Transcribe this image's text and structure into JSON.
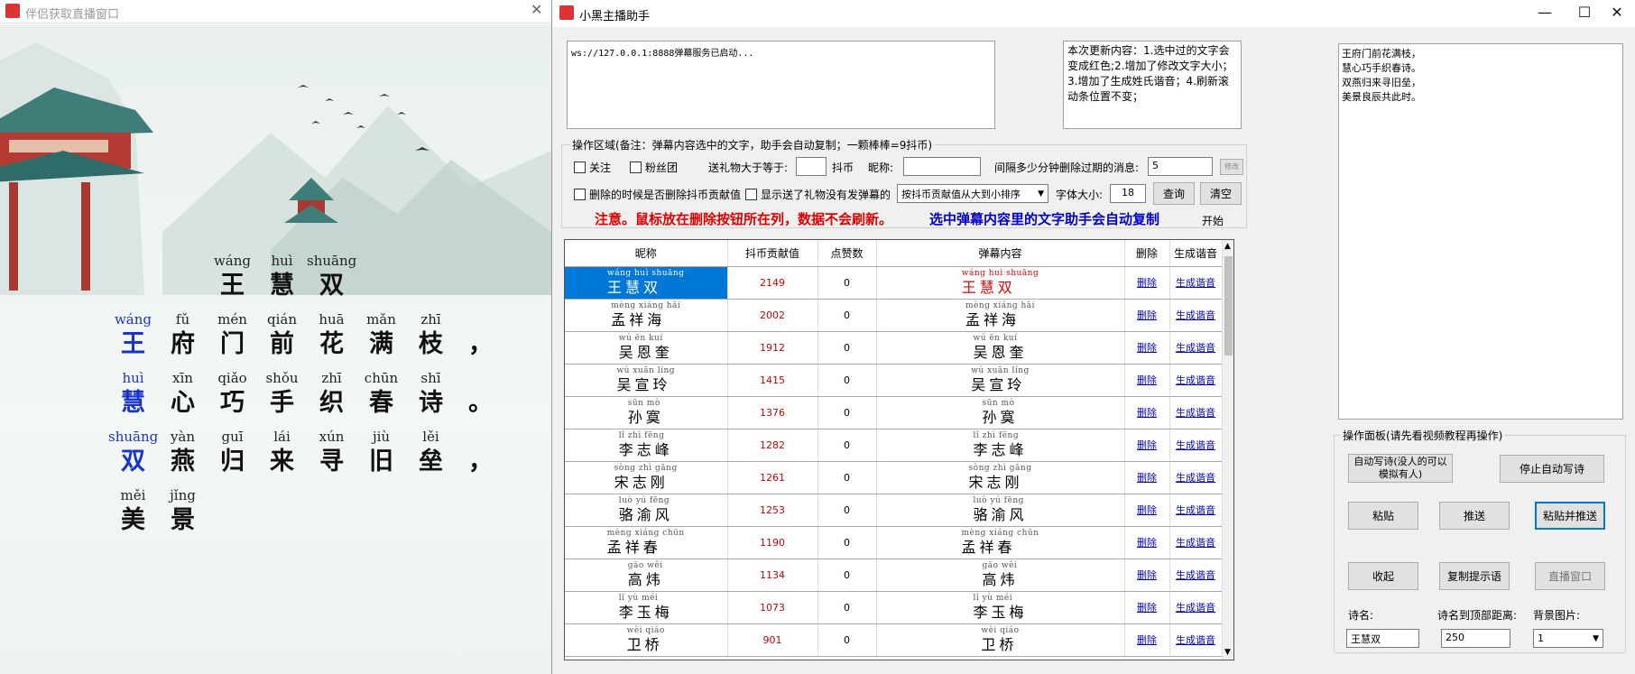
{
  "left_window": {
    "title": "伴侣获取直播窗口",
    "close_glyph": "✕",
    "poem": {
      "title": [
        {
          "py": "wáng",
          "hz": "王",
          "blue": false
        },
        {
          "py": "huì",
          "hz": "慧",
          "blue": false
        },
        {
          "py": "shuāng",
          "hz": "双",
          "blue": false
        }
      ],
      "lines": [
        [
          {
            "py": "wáng",
            "hz": "王",
            "blue": true
          },
          {
            "py": "fǔ",
            "hz": "府"
          },
          {
            "py": "mén",
            "hz": "门"
          },
          {
            "py": "qián",
            "hz": "前"
          },
          {
            "py": "huā",
            "hz": "花"
          },
          {
            "py": "mǎn",
            "hz": "满"
          },
          {
            "py": "zhī",
            "hz": "枝"
          },
          {
            "py": "",
            "hz": "，"
          }
        ],
        [
          {
            "py": "huì",
            "hz": "慧",
            "blue": true
          },
          {
            "py": "xīn",
            "hz": "心"
          },
          {
            "py": "qiǎo",
            "hz": "巧"
          },
          {
            "py": "shǒu",
            "hz": "手"
          },
          {
            "py": "zhī",
            "hz": "织"
          },
          {
            "py": "chūn",
            "hz": "春"
          },
          {
            "py": "shī",
            "hz": "诗"
          },
          {
            "py": "",
            "hz": "。"
          }
        ],
        [
          {
            "py": "shuāng",
            "hz": "双",
            "blue": true
          },
          {
            "py": "yàn",
            "hz": "燕"
          },
          {
            "py": "guī",
            "hz": "归"
          },
          {
            "py": "lái",
            "hz": "来"
          },
          {
            "py": "xún",
            "hz": "寻"
          },
          {
            "py": "jiù",
            "hz": "旧"
          },
          {
            "py": "lěi",
            "hz": "垒"
          },
          {
            "py": "",
            "hz": "，"
          }
        ],
        [
          {
            "py": "měi",
            "hz": "美"
          },
          {
            "py": "jǐng",
            "hz": "景"
          }
        ]
      ]
    }
  },
  "main_window": {
    "title": "小黑主播助手",
    "min_glyph": "—",
    "max_glyph": "☐",
    "close_glyph": "✕",
    "log_text": "ws://127.0.0.1:8888弹幕服务已启动...",
    "update_notes": "本次更新内容：1.选中过的文字会变成红色;2.增加了修改文字大小；3.增加了生成姓氏谐音；4.刷新滚动条位置不变；",
    "poem_output": "王府门前花满枝，\n慧心巧手织春诗。\n双燕归来寻旧垒，\n美景良辰共此时。",
    "ops": {
      "legend": "操作区域(备注：弹幕内容选中的文字，助手会自动复制；一颗棒棒=9抖币)",
      "follow_label": "关注",
      "fans_label": "粉丝团",
      "gift_label": "送礼物大于等于:",
      "gift_value": "",
      "coin_unit": "抖币",
      "nick_label": "昵称:",
      "nick_value": "",
      "interval_label": "间隔多少分钟删除过期的消息:",
      "interval_value": "5",
      "small_btn": "修改",
      "del_coin_label": "删除的时候是否删除抖币贡献值",
      "show_gift_label": "显示送了礼物没有发弹幕的",
      "sort_value": "按抖币贡献值从大到小排序",
      "font_label": "字体大小:",
      "font_value": "18",
      "query_btn": "查询",
      "clear_btn": "清空",
      "notice_red": "注意。鼠标放在删除按钮所在列，数据不会刷新。",
      "notice_blue": "选中弹幕内容里的文字助手会自动复制",
      "start_label": "开始"
    },
    "table": {
      "headers": [
        "昵称",
        "抖币贡献值",
        "点赞数",
        "弹幕内容",
        "删除",
        "生成谐音"
      ],
      "delete_label": "删除",
      "homophone_label": "生成谐音",
      "rows": [
        {
          "py": "wáng huì shuāng",
          "name": "王慧双",
          "coins": "2149",
          "likes": "0",
          "selected": true
        },
        {
          "py": "mèng xiáng hǎi",
          "name": "孟祥海",
          "coins": "2002",
          "likes": "0"
        },
        {
          "py": "wú ēn kuí",
          "name": "吴恩奎",
          "coins": "1912",
          "likes": "0"
        },
        {
          "py": "wú xuān líng",
          "name": "吴宣玲",
          "coins": "1415",
          "likes": "0"
        },
        {
          "py": "sūn mò",
          "name": "孙寞",
          "coins": "1376",
          "likes": "0"
        },
        {
          "py": "lǐ zhì fēng",
          "name": "李志峰",
          "coins": "1282",
          "likes": "0"
        },
        {
          "py": "sòng zhì gāng",
          "name": "宋志刚",
          "coins": "1261",
          "likes": "0"
        },
        {
          "py": "luò yú fēng",
          "name": "骆渝风",
          "coins": "1253",
          "likes": "0"
        },
        {
          "py": "mèng xiáng chūn",
          "name": "孟祥春",
          "coins": "1190",
          "likes": "0"
        },
        {
          "py": "gāo wěi",
          "name": "高炜",
          "coins": "1134",
          "likes": "0"
        },
        {
          "py": "lǐ yù méi",
          "name": "李玉梅",
          "coins": "1073",
          "likes": "0"
        },
        {
          "py": "wèi qiáo",
          "name": "卫桥",
          "coins": "901",
          "likes": "0"
        }
      ]
    },
    "panel": {
      "legend": "操作面板(请先看视频教程再操作)",
      "auto_write_btn": "自动写诗(没人的可以模拟有人)",
      "stop_auto_btn": "停止自动写诗",
      "paste_btn": "粘贴",
      "push_btn": "推送",
      "paste_push_btn": "粘贴并推送",
      "collapse_btn": "收起",
      "copy_hint_btn": "复制提示语",
      "live_window_btn": "直播窗口",
      "poem_name_label": "诗名:",
      "poem_name_value": "王慧双",
      "top_dist_label": "诗名到顶部距离:",
      "top_dist_value": "250",
      "bg_label": "背景图片:",
      "bg_value": "1"
    }
  },
  "colors": {
    "selected_bg": "#0078d7",
    "notice_red": "#e00000",
    "notice_blue": "#0000cc",
    "poem_blue": "#1a33c8"
  }
}
